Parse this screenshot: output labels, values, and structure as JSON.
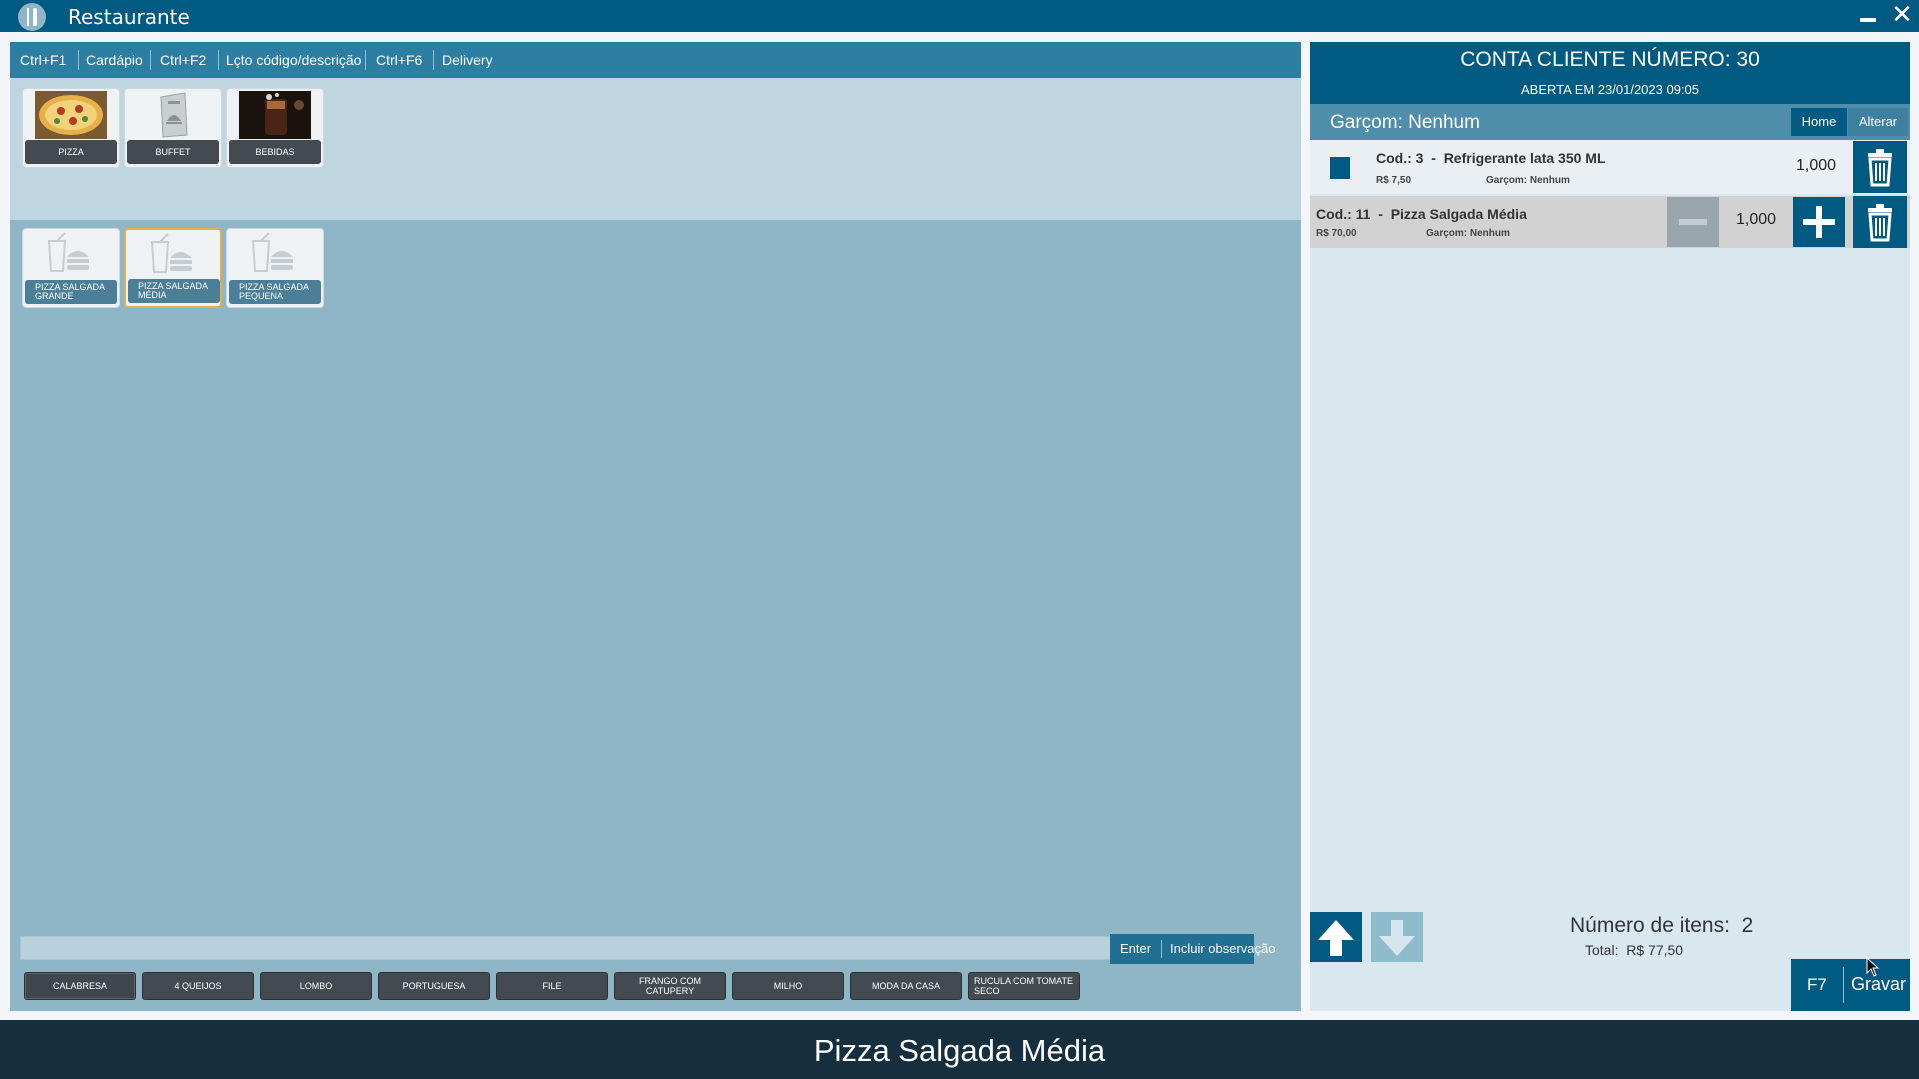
{
  "window": {
    "title": "Restaurante"
  },
  "nav": [
    {
      "key": "Ctrl+F1",
      "label": "Cardápio"
    },
    {
      "key": "Ctrl+F2",
      "label": "Lçto código/descrição"
    },
    {
      "key": "Ctrl+F6",
      "label": "Delivery"
    }
  ],
  "categories": [
    {
      "label": "PIZZA",
      "icon": "pizza-photo"
    },
    {
      "label": "BUFFET",
      "icon": "menu-photo"
    },
    {
      "label": "BEBIDAS",
      "icon": "drink-photo"
    }
  ],
  "products": [
    {
      "label": "PIZZA SALGADA GRANDE",
      "icon": "fastfood-icon",
      "selected": false
    },
    {
      "label": "PIZZA SALGADA MÉDIA",
      "icon": "fastfood-icon",
      "selected": true
    },
    {
      "label": "PIZZA SALGADA PEQUENA",
      "icon": "fastfood-icon",
      "selected": false
    }
  ],
  "search": {
    "value": "",
    "enter_key": "Enter",
    "enter_label": "Incluir observação"
  },
  "flavors": [
    "CALABRESA",
    "4 QUEIJOS",
    "LOMBO",
    "PORTUGUESA",
    "FILE",
    "FRANGO COM CATUPERY",
    "MILHO",
    "MODA DA CASA",
    "RUCULA COM TOMATE SECO"
  ],
  "account": {
    "title": "CONTA CLIENTE NÚMERO: 30",
    "opened": "ABERTA EM 23/01/2023 09:05",
    "waiter": "Garçom: Nenhum",
    "home_label": "Home",
    "alter_label": "Alterar"
  },
  "order_items": [
    {
      "code": "Cod.: 3",
      "sep": "-",
      "name": "Refrigerante lata 350 ML",
      "price": "R$ 7,50",
      "waiter": "Garçom: Nenhum",
      "qty": "1,000"
    },
    {
      "code": "Cod.: 11",
      "sep": "-",
      "name": "Pizza Salgada Média",
      "price": "R$ 70,00",
      "waiter": "Garçom: Nenhum",
      "qty": "1,000"
    }
  ],
  "summary": {
    "count_label": "Número de itens:",
    "count": "2",
    "total_label": "Total:",
    "total": "R$ 77,50"
  },
  "save": {
    "key": "F7",
    "label": "Gravar"
  },
  "status": {
    "text": "Pizza Salgada Média"
  },
  "colors": {
    "primary": "#005a82",
    "panel": "#8eb6c7",
    "status_bar": "#162f3e",
    "selected_border": "#e2b04a"
  }
}
